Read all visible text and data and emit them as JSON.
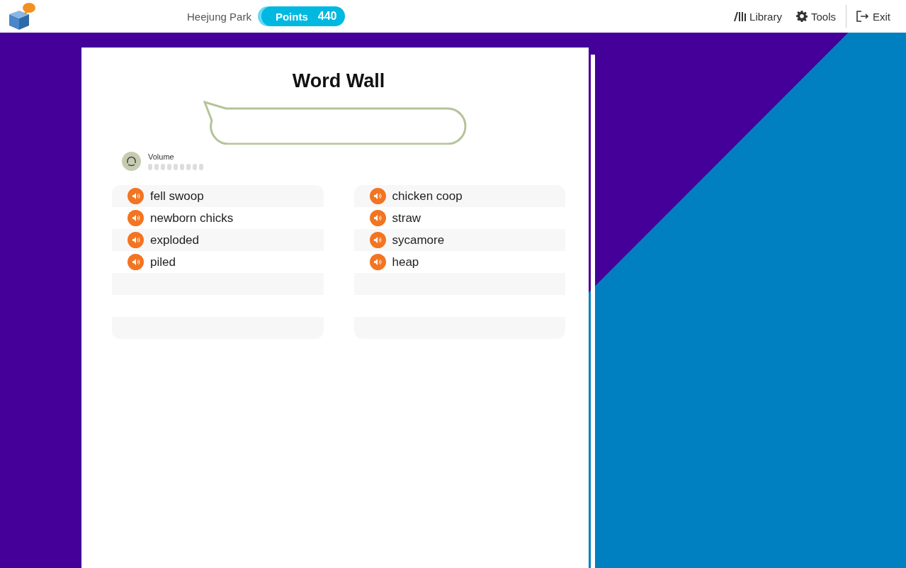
{
  "header": {
    "user_name": "Heejung Park",
    "points_label": "Points",
    "points_value": "440",
    "nav": [
      {
        "kind": "library",
        "label": "Library"
      },
      {
        "kind": "tools",
        "label": "Tools"
      },
      {
        "kind": "exit",
        "label": "Exit"
      }
    ]
  },
  "activity": {
    "title": "Word Wall",
    "volume": {
      "label": "Volume"
    },
    "columns": [
      {
        "words": [
          "fell swoop",
          "newborn chicks",
          "exploded",
          "piled"
        ]
      },
      {
        "words": [
          "chicken coop",
          "straw",
          "sycamore",
          "heap"
        ]
      }
    ]
  }
}
